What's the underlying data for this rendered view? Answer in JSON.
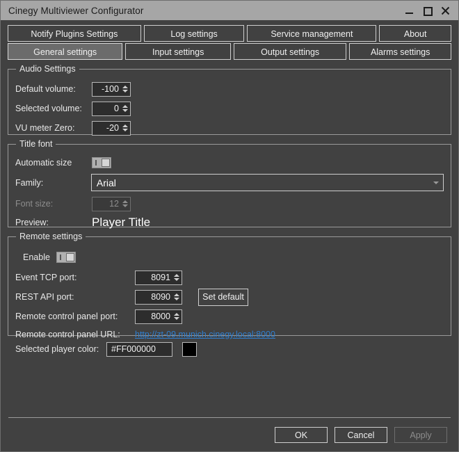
{
  "window": {
    "title": "Cinegy Multiviewer Configurator",
    "controls": {
      "minimize": "minimize-icon",
      "maximize": "maximize-icon",
      "close": "close-icon"
    }
  },
  "tabs": {
    "row1": [
      {
        "label": "Notify Plugins Settings",
        "active": false
      },
      {
        "label": "Log settings",
        "active": false
      },
      {
        "label": "Service management",
        "active": false
      },
      {
        "label": "About",
        "active": false
      }
    ],
    "row2": [
      {
        "label": "General settings",
        "active": true
      },
      {
        "label": "Input settings",
        "active": false
      },
      {
        "label": "Output settings",
        "active": false
      },
      {
        "label": "Alarms settings",
        "active": false
      }
    ]
  },
  "audio_settings": {
    "title": "Audio Settings",
    "default_volume": {
      "label": "Default volume:",
      "value": "-100"
    },
    "selected_volume": {
      "label": "Selected volume:",
      "value": "0"
    },
    "vu_meter_zero": {
      "label": "VU meter Zero:",
      "value": "-20"
    }
  },
  "title_font": {
    "title": "Title font",
    "automatic_size": {
      "label": "Automatic size",
      "state": "on"
    },
    "family": {
      "label": "Family:",
      "value": "Arial"
    },
    "font_size": {
      "label": "Font size:",
      "value": "12",
      "enabled": false
    },
    "preview": {
      "label": "Preview:",
      "value": "Player Title"
    }
  },
  "remote_settings": {
    "title": "Remote settings",
    "enable": {
      "label": "Enable",
      "state": "on"
    },
    "event_tcp_port": {
      "label": "Event TCP port:",
      "value": "8091"
    },
    "rest_api_port": {
      "label": "REST API port:",
      "value": "8090"
    },
    "set_default_button": "Set default",
    "remote_control_panel_port": {
      "label": "Remote control panel port:",
      "value": "8000"
    },
    "remote_control_panel_url": {
      "label": "Remote control panel URL:",
      "value": "http://zt-09.munich.cinegy.local:8000"
    }
  },
  "selected_player_color": {
    "label": "Selected player color:",
    "value": "#FF000000",
    "swatch_color": "#000000"
  },
  "footer": {
    "ok": "OK",
    "cancel": "Cancel",
    "apply": "Apply",
    "apply_enabled": false
  },
  "theme": {
    "background": "#414141",
    "titlebar": "#a6a6a6",
    "active_tab": "#6b6b6b",
    "border": "#cfcfcf",
    "link": "#2f7fd0",
    "field_background": "#2d2d2d"
  }
}
